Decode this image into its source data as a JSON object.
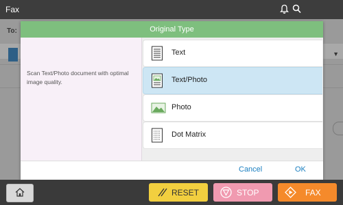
{
  "topbar": {
    "title": "Fax",
    "icons": [
      "bell-icon",
      "search-icon"
    ]
  },
  "background": {
    "to_label": "To:"
  },
  "dialog": {
    "title": "Original Type",
    "description": "Scan Text/Photo document with optimal image quality.",
    "options": [
      {
        "label": "Text",
        "icon": "text-document-icon",
        "selected": false
      },
      {
        "label": "Text/Photo",
        "icon": "text-photo-document-icon",
        "selected": true
      },
      {
        "label": "Photo",
        "icon": "photo-icon",
        "selected": false
      },
      {
        "label": "Dot Matrix",
        "icon": "dot-matrix-document-icon",
        "selected": false
      }
    ],
    "cancel_label": "Cancel",
    "ok_label": "OK"
  },
  "bottombar": {
    "home_icon": "home-icon",
    "reset_label": "RESET",
    "stop_label": "STOP",
    "fax_label": "FAX",
    "colors": {
      "reset": "#f2cf3f",
      "stop": "#f09ab0",
      "fax": "#f58a2b"
    }
  },
  "colors": {
    "header_accent": "#7ebf7e",
    "selected_row": "#cde6f4",
    "link": "#1a7fc0"
  }
}
